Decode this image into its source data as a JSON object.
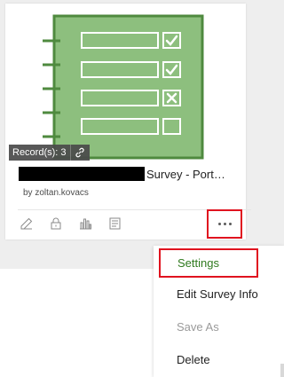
{
  "card": {
    "records_label": "Record(s): 3",
    "title_suffix": "Survey - Port…",
    "owner": "by zoltan.kovacs",
    "actions": [
      "edit-icon",
      "lock-icon",
      "chart-icon",
      "form-icon"
    ],
    "more_icon": "ellipsis-icon"
  },
  "menu": {
    "items": [
      {
        "label": "Settings",
        "state": "selected"
      },
      {
        "label": "Edit Survey Info",
        "state": "enabled"
      },
      {
        "label": "Save As",
        "state": "disabled"
      },
      {
        "label": "Delete",
        "state": "enabled"
      }
    ]
  },
  "colors": {
    "thumbnail_green": "#8dbf7e",
    "thumbnail_dark_green": "#4f8a3f",
    "highlight_red": "#e0131f",
    "selected_text_green": "#2f7a1e"
  }
}
